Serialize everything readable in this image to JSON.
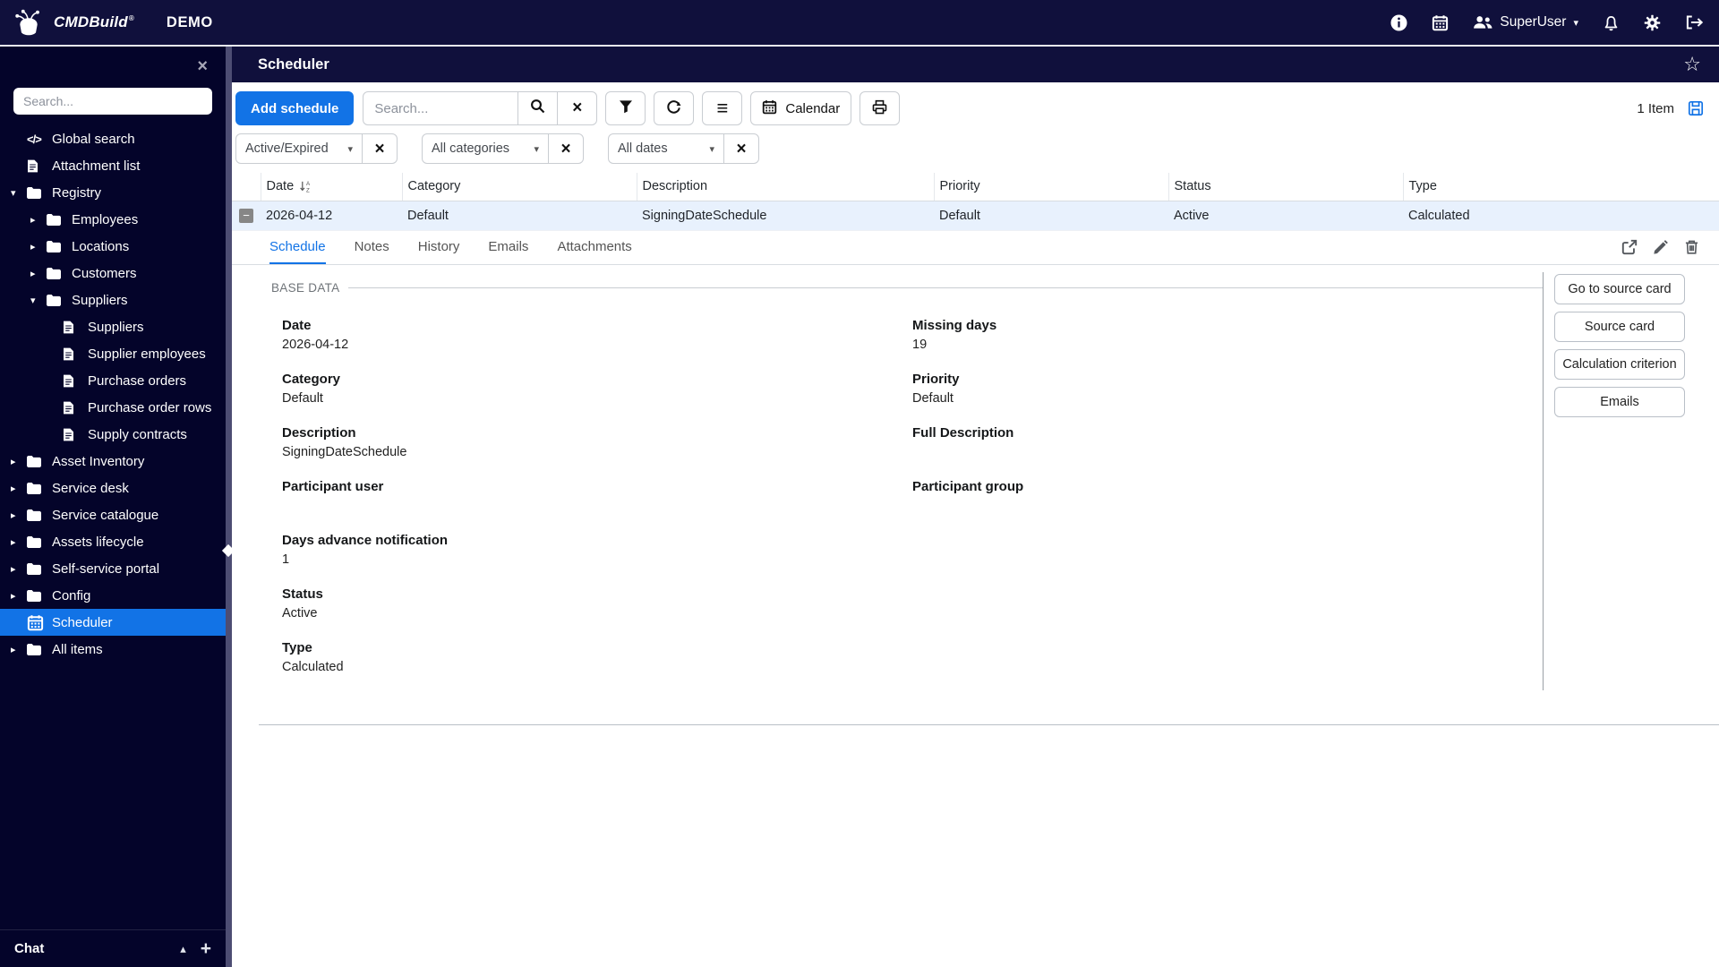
{
  "colors": {
    "accent": "#1273e6",
    "topbar_bg": "#10103c",
    "sidebar_bg": "#04042a",
    "splitter": "#4d4d73",
    "selected_row_bg": "#e8f1fd"
  },
  "glyphs": {
    "caret-down": "▾",
    "caret-right": "▸",
    "caret-up": "▴",
    "close": "×",
    "hamburger": "≡",
    "star": "☆",
    "plus": "+",
    "minus": "−",
    "code": "</>",
    "registered": "®"
  },
  "topbar": {
    "brand": "CMDBuild",
    "env_label": "DEMO",
    "user": "SuperUser"
  },
  "sidebar": {
    "search_placeholder": "Search...",
    "chat_label": "Chat",
    "items": [
      {
        "label": "Global search",
        "icon": "code",
        "level": 0
      },
      {
        "label": "Attachment list",
        "icon": "file",
        "level": 0
      },
      {
        "label": "Registry",
        "icon": "folder",
        "caret": "down",
        "level": 0
      },
      {
        "label": "Employees",
        "icon": "folder",
        "caret": "right",
        "level": 1
      },
      {
        "label": "Locations",
        "icon": "folder",
        "caret": "right",
        "level": 1
      },
      {
        "label": "Customers",
        "icon": "folder",
        "caret": "right",
        "level": 1
      },
      {
        "label": "Suppliers",
        "icon": "folder",
        "caret": "down",
        "level": 1
      },
      {
        "label": "Suppliers",
        "icon": "file",
        "level": 2
      },
      {
        "label": "Supplier employees",
        "icon": "file",
        "level": 2
      },
      {
        "label": "Purchase orders",
        "icon": "file",
        "level": 2
      },
      {
        "label": "Purchase order rows",
        "icon": "file",
        "level": 2
      },
      {
        "label": "Supply contracts",
        "icon": "file",
        "level": 2
      },
      {
        "label": "Asset Inventory",
        "icon": "folder",
        "caret": "right",
        "level": 0
      },
      {
        "label": "Service desk",
        "icon": "folder",
        "caret": "right",
        "level": 0
      },
      {
        "label": "Service catalogue",
        "icon": "folder",
        "caret": "right",
        "level": 0
      },
      {
        "label": "Assets lifecycle",
        "icon": "folder",
        "caret": "right",
        "level": 0
      },
      {
        "label": "Self-service portal",
        "icon": "folder",
        "caret": "right",
        "level": 0
      },
      {
        "label": "Config",
        "icon": "folder",
        "caret": "right",
        "level": 0
      },
      {
        "label": "Scheduler",
        "icon": "calendar",
        "level": 0,
        "active": true
      },
      {
        "label": "All items",
        "icon": "folder",
        "caret": "right",
        "level": 0
      }
    ]
  },
  "main": {
    "title": "Scheduler",
    "toolbar": {
      "add_button": "Add schedule",
      "search_placeholder": "Search...",
      "calendar_button": "Calendar",
      "item_count": "1 Item"
    },
    "filters": [
      {
        "value": "Active/Expired"
      },
      {
        "value": "All categories"
      },
      {
        "value": "All dates"
      }
    ],
    "table": {
      "columns": [
        "Date",
        "Category",
        "Description",
        "Priority",
        "Status",
        "Type"
      ],
      "sort_column": "Date",
      "rows": [
        {
          "date": "2026-04-12",
          "category": "Default",
          "description": "SigningDateSchedule",
          "priority": "Default",
          "status": "Active",
          "type": "Calculated"
        }
      ]
    },
    "tabs": [
      {
        "label": "Schedule",
        "active": true
      },
      {
        "label": "Notes"
      },
      {
        "label": "History"
      },
      {
        "label": "Emails"
      },
      {
        "label": "Attachments"
      }
    ],
    "detail": {
      "section_title": "BASE DATA",
      "rows": [
        {
          "left": {
            "label": "Date",
            "value": "2026-04-12"
          },
          "right": {
            "label": "Missing days",
            "value": "19"
          }
        },
        {
          "left": {
            "label": "Category",
            "value": "Default"
          },
          "right": {
            "label": "Priority",
            "value": "Default"
          }
        },
        {
          "left": {
            "label": "Description",
            "value": "SigningDateSchedule"
          },
          "right": {
            "label": "Full Description",
            "value": ""
          }
        },
        {
          "left": {
            "label": "Participant user",
            "value": ""
          },
          "right": {
            "label": "Participant group",
            "value": ""
          }
        },
        {
          "left": {
            "label": "Days advance notification",
            "value": "1"
          }
        },
        {
          "left": {
            "label": "Status",
            "value": "Active"
          }
        },
        {
          "left": {
            "label": "Type",
            "value": "Calculated"
          }
        }
      ],
      "actions": [
        "Go to source card",
        "Source card",
        "Calculation criterion",
        "Emails"
      ]
    }
  }
}
